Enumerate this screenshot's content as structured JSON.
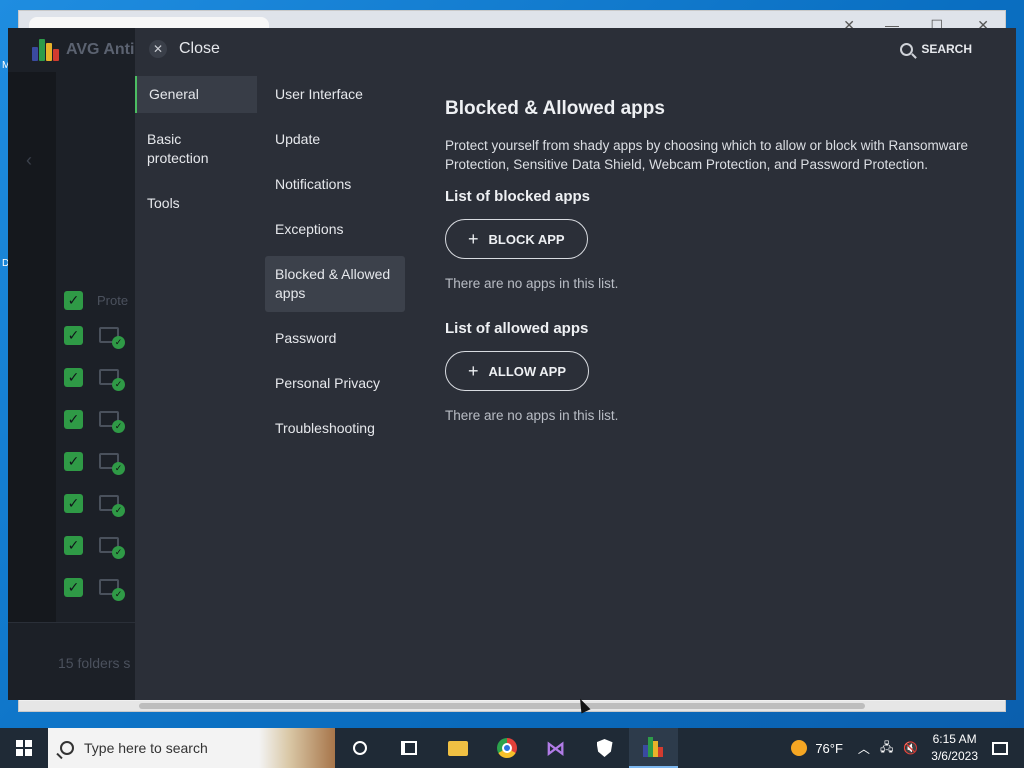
{
  "avg_window": {
    "brand": "AVG Anti",
    "list_header": "Prote",
    "footer_text": "15 folders s",
    "row_count": 7
  },
  "settings": {
    "close_label": "Close",
    "search_label": "SEARCH",
    "categories": [
      {
        "label": "General",
        "active": true
      },
      {
        "label": "Basic protection",
        "active": false
      },
      {
        "label": "Tools",
        "active": false
      }
    ],
    "subcategories": [
      {
        "label": "User Interface",
        "active": false
      },
      {
        "label": "Update",
        "active": false
      },
      {
        "label": "Notifications",
        "active": false
      },
      {
        "label": "Exceptions",
        "active": false
      },
      {
        "label": "Blocked & Allowed apps",
        "active": true
      },
      {
        "label": "Password",
        "active": false
      },
      {
        "label": "Personal Privacy",
        "active": false
      },
      {
        "label": "Troubleshooting",
        "active": false
      }
    ],
    "content": {
      "title": "Blocked & Allowed apps",
      "description": "Protect yourself from shady apps by choosing which to allow or block with Ransomware Protection, Sensitive Data Shield, Webcam Protection, and Password Protection.",
      "blocked_title": "List of blocked apps",
      "block_button": "BLOCK APP",
      "blocked_empty": "There are no apps in this list.",
      "allowed_title": "List of allowed apps",
      "allow_button": "ALLOW APP",
      "allowed_empty": "There are no apps in this list."
    }
  },
  "taskbar": {
    "search_placeholder": "Type here to search",
    "temperature": "76°F",
    "time": "6:15 AM",
    "date": "3/6/2023"
  }
}
